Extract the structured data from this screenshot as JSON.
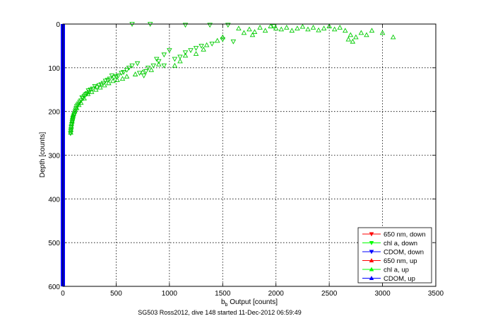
{
  "chart_data": {
    "type": "scatter",
    "xlabel": "b",
    "xlabel_subscript": "b",
    "xlabel_rest": " Output [counts]",
    "ylabel": "Depth [counts]",
    "caption": "SG503 Ross2012, dive 148 started 11-Dec-2012 06:59:49",
    "xlim": [
      0,
      3500
    ],
    "ylim": [
      600,
      0
    ],
    "xticks": [
      "0",
      "500",
      "1000",
      "1500",
      "2000",
      "2500",
      "3000",
      "3500"
    ],
    "yticks": [
      "0",
      "100",
      "200",
      "300",
      "400",
      "500",
      "600"
    ],
    "grid": true,
    "legend_position": "bottom-right",
    "legend": [
      {
        "name": "650 nm, down",
        "color": "#ff0000",
        "marker": "triangle-down"
      },
      {
        "name": "chl a, down",
        "color": "#00ff00",
        "marker": "triangle-down"
      },
      {
        "name": "CDOM, down",
        "color": "#0000ff",
        "marker": "triangle-down"
      },
      {
        "name": "650 nm, up",
        "color": "#ff0000",
        "marker": "triangle-up"
      },
      {
        "name": "chl a, up",
        "color": "#00ff00",
        "marker": "triangle-up"
      },
      {
        "name": "CDOM, up",
        "color": "#0000ff",
        "marker": "triangle-up"
      }
    ],
    "series": [
      {
        "name": "chl a, down",
        "marker": "triangle-down",
        "color": "#00cc00",
        "points": [
          [
            650,
            0
          ],
          [
            820,
            0
          ],
          [
            1150,
            2
          ],
          [
            1380,
            2
          ],
          [
            1550,
            2
          ],
          [
            1980,
            5
          ],
          [
            1500,
            35
          ],
          [
            1400,
            45
          ],
          [
            1250,
            55
          ],
          [
            1200,
            60
          ],
          [
            1150,
            65
          ],
          [
            1100,
            75
          ],
          [
            1050,
            80
          ],
          [
            1000,
            60
          ],
          [
            950,
            70
          ],
          [
            900,
            85
          ],
          [
            850,
            95
          ],
          [
            800,
            100
          ],
          [
            780,
            108
          ],
          [
            760,
            118
          ],
          [
            720,
            112
          ],
          [
            700,
            90
          ],
          [
            650,
            95
          ],
          [
            620,
            100
          ],
          [
            600,
            105
          ],
          [
            570,
            110
          ],
          [
            550,
            112
          ],
          [
            520,
            118
          ],
          [
            500,
            120
          ],
          [
            480,
            122
          ],
          [
            460,
            118
          ],
          [
            440,
            125
          ],
          [
            420,
            128
          ],
          [
            400,
            130
          ],
          [
            380,
            135
          ],
          [
            360,
            138
          ],
          [
            340,
            140
          ],
          [
            320,
            145
          ],
          [
            300,
            142
          ],
          [
            280,
            148
          ],
          [
            260,
            150
          ],
          [
            250,
            155
          ],
          [
            240,
            152
          ],
          [
            230,
            158
          ],
          [
            220,
            160
          ],
          [
            210,
            162
          ],
          [
            200,
            165
          ],
          [
            190,
            170
          ],
          [
            180,
            168
          ],
          [
            170,
            175
          ],
          [
            160,
            178
          ],
          [
            150,
            182
          ],
          [
            140,
            185
          ],
          [
            130,
            188
          ],
          [
            125,
            192
          ],
          [
            120,
            196
          ],
          [
            115,
            200
          ],
          [
            110,
            205
          ],
          [
            105,
            208
          ],
          [
            100,
            212
          ],
          [
            95,
            215
          ],
          [
            92,
            220
          ],
          [
            88,
            225
          ],
          [
            85,
            230
          ],
          [
            80,
            235
          ],
          [
            78,
            240
          ],
          [
            75,
            245
          ],
          [
            72,
            250
          ],
          [
            950,
            95
          ],
          [
            880,
            80
          ],
          [
            1300,
            50
          ],
          [
            1600,
            40
          ]
        ]
      },
      {
        "name": "chl a, up",
        "marker": "triangle-up",
        "color": "#00cc00",
        "points": [
          [
            1650,
            10
          ],
          [
            1750,
            12
          ],
          [
            1800,
            18
          ],
          [
            1850,
            8
          ],
          [
            1900,
            15
          ],
          [
            1950,
            5
          ],
          [
            2000,
            10
          ],
          [
            2050,
            12
          ],
          [
            2100,
            8
          ],
          [
            2150,
            15
          ],
          [
            2200,
            10
          ],
          [
            2250,
            6
          ],
          [
            2300,
            12
          ],
          [
            2350,
            8
          ],
          [
            2400,
            14
          ],
          [
            2450,
            10
          ],
          [
            2500,
            5
          ],
          [
            2550,
            12
          ],
          [
            2600,
            8
          ],
          [
            2650,
            15
          ],
          [
            2700,
            25
          ],
          [
            2750,
            30
          ],
          [
            2800,
            20
          ],
          [
            2850,
            25
          ],
          [
            2900,
            15
          ],
          [
            3000,
            20
          ],
          [
            3100,
            30
          ],
          [
            2680,
            35
          ],
          [
            2720,
            40
          ],
          [
            1700,
            20
          ],
          [
            1780,
            25
          ],
          [
            1500,
            30
          ],
          [
            1450,
            38
          ],
          [
            1350,
            48
          ],
          [
            1320,
            58
          ],
          [
            1250,
            68
          ],
          [
            1150,
            72
          ],
          [
            1100,
            85
          ],
          [
            1050,
            95
          ],
          [
            900,
            92
          ],
          [
            830,
            105
          ],
          [
            750,
            110
          ],
          [
            680,
            115
          ],
          [
            600,
            120
          ],
          [
            560,
            125
          ],
          [
            510,
            128
          ],
          [
            470,
            130
          ],
          [
            430,
            135
          ],
          [
            390,
            140
          ],
          [
            350,
            145
          ],
          [
            310,
            150
          ],
          [
            270,
            155
          ],
          [
            235,
            160
          ],
          [
            200,
            170
          ],
          [
            170,
            180
          ],
          [
            150,
            185
          ],
          [
            130,
            192
          ],
          [
            110,
            200
          ],
          [
            100,
            205
          ],
          [
            95,
            210
          ],
          [
            90,
            215
          ],
          [
            85,
            222
          ],
          [
            80,
            228
          ],
          [
            78,
            235
          ],
          [
            76,
            242
          ],
          [
            74,
            248
          ]
        ]
      },
      {
        "name": "CDOM",
        "marker": "line",
        "color": "#0000ff",
        "points": [
          [
            0,
            0
          ],
          [
            0,
            600
          ]
        ]
      }
    ]
  }
}
